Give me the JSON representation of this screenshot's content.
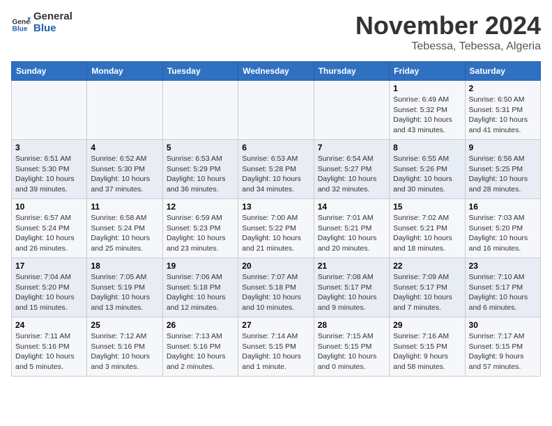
{
  "header": {
    "logo_general": "General",
    "logo_blue": "Blue",
    "month_year": "November 2024",
    "location": "Tebessa, Tebessa, Algeria"
  },
  "weekdays": [
    "Sunday",
    "Monday",
    "Tuesday",
    "Wednesday",
    "Thursday",
    "Friday",
    "Saturday"
  ],
  "weeks": [
    [
      {
        "day": "",
        "info": ""
      },
      {
        "day": "",
        "info": ""
      },
      {
        "day": "",
        "info": ""
      },
      {
        "day": "",
        "info": ""
      },
      {
        "day": "",
        "info": ""
      },
      {
        "day": "1",
        "info": "Sunrise: 6:49 AM\nSunset: 5:32 PM\nDaylight: 10 hours and 43 minutes."
      },
      {
        "day": "2",
        "info": "Sunrise: 6:50 AM\nSunset: 5:31 PM\nDaylight: 10 hours and 41 minutes."
      }
    ],
    [
      {
        "day": "3",
        "info": "Sunrise: 6:51 AM\nSunset: 5:30 PM\nDaylight: 10 hours and 39 minutes."
      },
      {
        "day": "4",
        "info": "Sunrise: 6:52 AM\nSunset: 5:30 PM\nDaylight: 10 hours and 37 minutes."
      },
      {
        "day": "5",
        "info": "Sunrise: 6:53 AM\nSunset: 5:29 PM\nDaylight: 10 hours and 36 minutes."
      },
      {
        "day": "6",
        "info": "Sunrise: 6:53 AM\nSunset: 5:28 PM\nDaylight: 10 hours and 34 minutes."
      },
      {
        "day": "7",
        "info": "Sunrise: 6:54 AM\nSunset: 5:27 PM\nDaylight: 10 hours and 32 minutes."
      },
      {
        "day": "8",
        "info": "Sunrise: 6:55 AM\nSunset: 5:26 PM\nDaylight: 10 hours and 30 minutes."
      },
      {
        "day": "9",
        "info": "Sunrise: 6:56 AM\nSunset: 5:25 PM\nDaylight: 10 hours and 28 minutes."
      }
    ],
    [
      {
        "day": "10",
        "info": "Sunrise: 6:57 AM\nSunset: 5:24 PM\nDaylight: 10 hours and 26 minutes."
      },
      {
        "day": "11",
        "info": "Sunrise: 6:58 AM\nSunset: 5:24 PM\nDaylight: 10 hours and 25 minutes."
      },
      {
        "day": "12",
        "info": "Sunrise: 6:59 AM\nSunset: 5:23 PM\nDaylight: 10 hours and 23 minutes."
      },
      {
        "day": "13",
        "info": "Sunrise: 7:00 AM\nSunset: 5:22 PM\nDaylight: 10 hours and 21 minutes."
      },
      {
        "day": "14",
        "info": "Sunrise: 7:01 AM\nSunset: 5:21 PM\nDaylight: 10 hours and 20 minutes."
      },
      {
        "day": "15",
        "info": "Sunrise: 7:02 AM\nSunset: 5:21 PM\nDaylight: 10 hours and 18 minutes."
      },
      {
        "day": "16",
        "info": "Sunrise: 7:03 AM\nSunset: 5:20 PM\nDaylight: 10 hours and 16 minutes."
      }
    ],
    [
      {
        "day": "17",
        "info": "Sunrise: 7:04 AM\nSunset: 5:20 PM\nDaylight: 10 hours and 15 minutes."
      },
      {
        "day": "18",
        "info": "Sunrise: 7:05 AM\nSunset: 5:19 PM\nDaylight: 10 hours and 13 minutes."
      },
      {
        "day": "19",
        "info": "Sunrise: 7:06 AM\nSunset: 5:18 PM\nDaylight: 10 hours and 12 minutes."
      },
      {
        "day": "20",
        "info": "Sunrise: 7:07 AM\nSunset: 5:18 PM\nDaylight: 10 hours and 10 minutes."
      },
      {
        "day": "21",
        "info": "Sunrise: 7:08 AM\nSunset: 5:17 PM\nDaylight: 10 hours and 9 minutes."
      },
      {
        "day": "22",
        "info": "Sunrise: 7:09 AM\nSunset: 5:17 PM\nDaylight: 10 hours and 7 minutes."
      },
      {
        "day": "23",
        "info": "Sunrise: 7:10 AM\nSunset: 5:17 PM\nDaylight: 10 hours and 6 minutes."
      }
    ],
    [
      {
        "day": "24",
        "info": "Sunrise: 7:11 AM\nSunset: 5:16 PM\nDaylight: 10 hours and 5 minutes."
      },
      {
        "day": "25",
        "info": "Sunrise: 7:12 AM\nSunset: 5:16 PM\nDaylight: 10 hours and 3 minutes."
      },
      {
        "day": "26",
        "info": "Sunrise: 7:13 AM\nSunset: 5:16 PM\nDaylight: 10 hours and 2 minutes."
      },
      {
        "day": "27",
        "info": "Sunrise: 7:14 AM\nSunset: 5:15 PM\nDaylight: 10 hours and 1 minute."
      },
      {
        "day": "28",
        "info": "Sunrise: 7:15 AM\nSunset: 5:15 PM\nDaylight: 10 hours and 0 minutes."
      },
      {
        "day": "29",
        "info": "Sunrise: 7:16 AM\nSunset: 5:15 PM\nDaylight: 9 hours and 58 minutes."
      },
      {
        "day": "30",
        "info": "Sunrise: 7:17 AM\nSunset: 5:15 PM\nDaylight: 9 hours and 57 minutes."
      }
    ]
  ]
}
